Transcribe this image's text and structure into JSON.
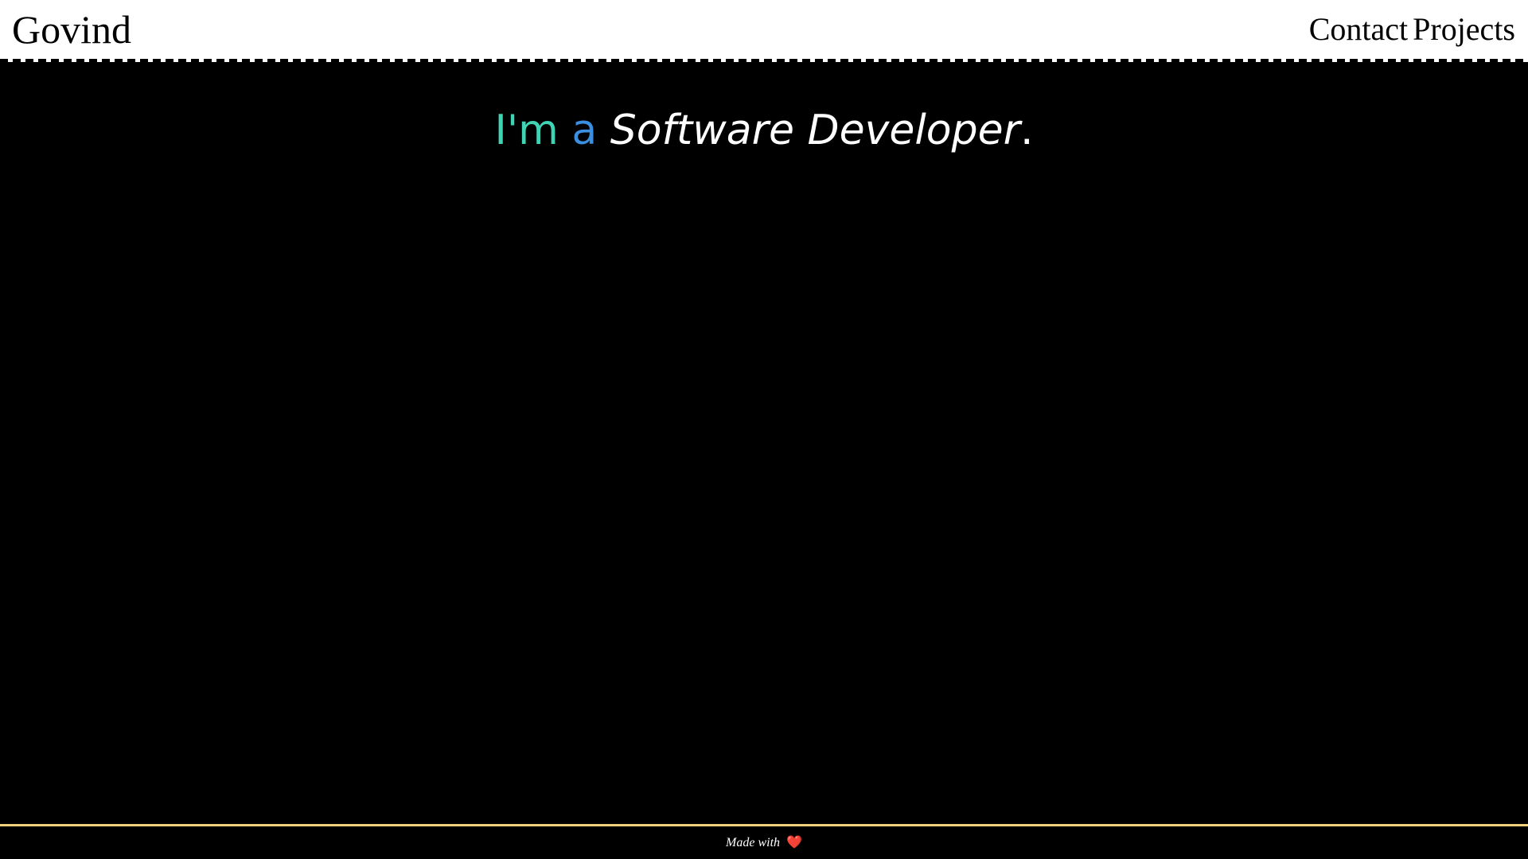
{
  "header": {
    "brand": "Govind",
    "nav": [
      {
        "label": "Contact"
      },
      {
        "label": "Projects"
      }
    ]
  },
  "hero": {
    "part1": "I'm",
    "part2": "a",
    "part3": "Software Developer",
    "part4": "."
  },
  "footer": {
    "made_with": "Made with",
    "heart_icon": "❤️"
  },
  "colors": {
    "accent_im": "#3fd4b4",
    "accent_a": "#3a8fe0",
    "footer_line": "#f2d27a",
    "heart": "#e53935"
  }
}
